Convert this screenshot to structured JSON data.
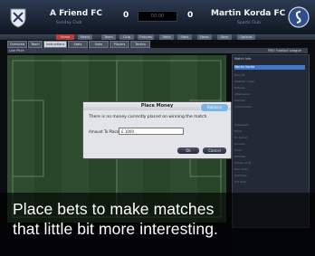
{
  "header": {
    "home_team": {
      "name": "A Friend FC",
      "subtitle": "Sunday Club",
      "score": "0"
    },
    "away_team": {
      "name": "Martin Korda FC",
      "subtitle": "Sports Club",
      "score": "0"
    },
    "clock": "00:00"
  },
  "nav": {
    "buttons": [
      "Home",
      "Match",
      "Team",
      "Club",
      "Fixtures",
      "Table",
      "Stats",
      "News",
      "Save",
      "Options"
    ]
  },
  "tabs": [
    "Overview",
    "Team",
    "Instructions",
    "Stats",
    "Subs",
    "Players",
    "Tactics"
  ],
  "subheader": {
    "left": "Live Pitch",
    "right": "FMO Football League"
  },
  "side_panel": {
    "title": "Match Info",
    "highlight": "Martin Korda",
    "rows": [
      "Kick off",
      "Weather: Clear",
      "Referee",
      "Attendance",
      "Stadium",
      "Commentary",
      "Possession",
      "Shots",
      "On target",
      "Corners",
      "Fouls",
      "Offsides",
      "Yellow cards",
      "Red cards",
      "Half time",
      "Full time"
    ]
  },
  "dialog": {
    "title": "Place Money",
    "message": "There is no money currently placed on winning the match.",
    "amount_label": "Amount To Place",
    "amount_value": "£ 1000",
    "ok_label": "Ok",
    "cancel_label": "Cancel",
    "badge": "Balance"
  },
  "caption": {
    "line1": "Place bets to make matches",
    "line2": "that little bit more interesting."
  },
  "colors": {
    "header": "#1f2a3d",
    "pitch": "#2c4a2e",
    "dialog": "#e2e4e9",
    "active_tab": "#b7413a"
  }
}
